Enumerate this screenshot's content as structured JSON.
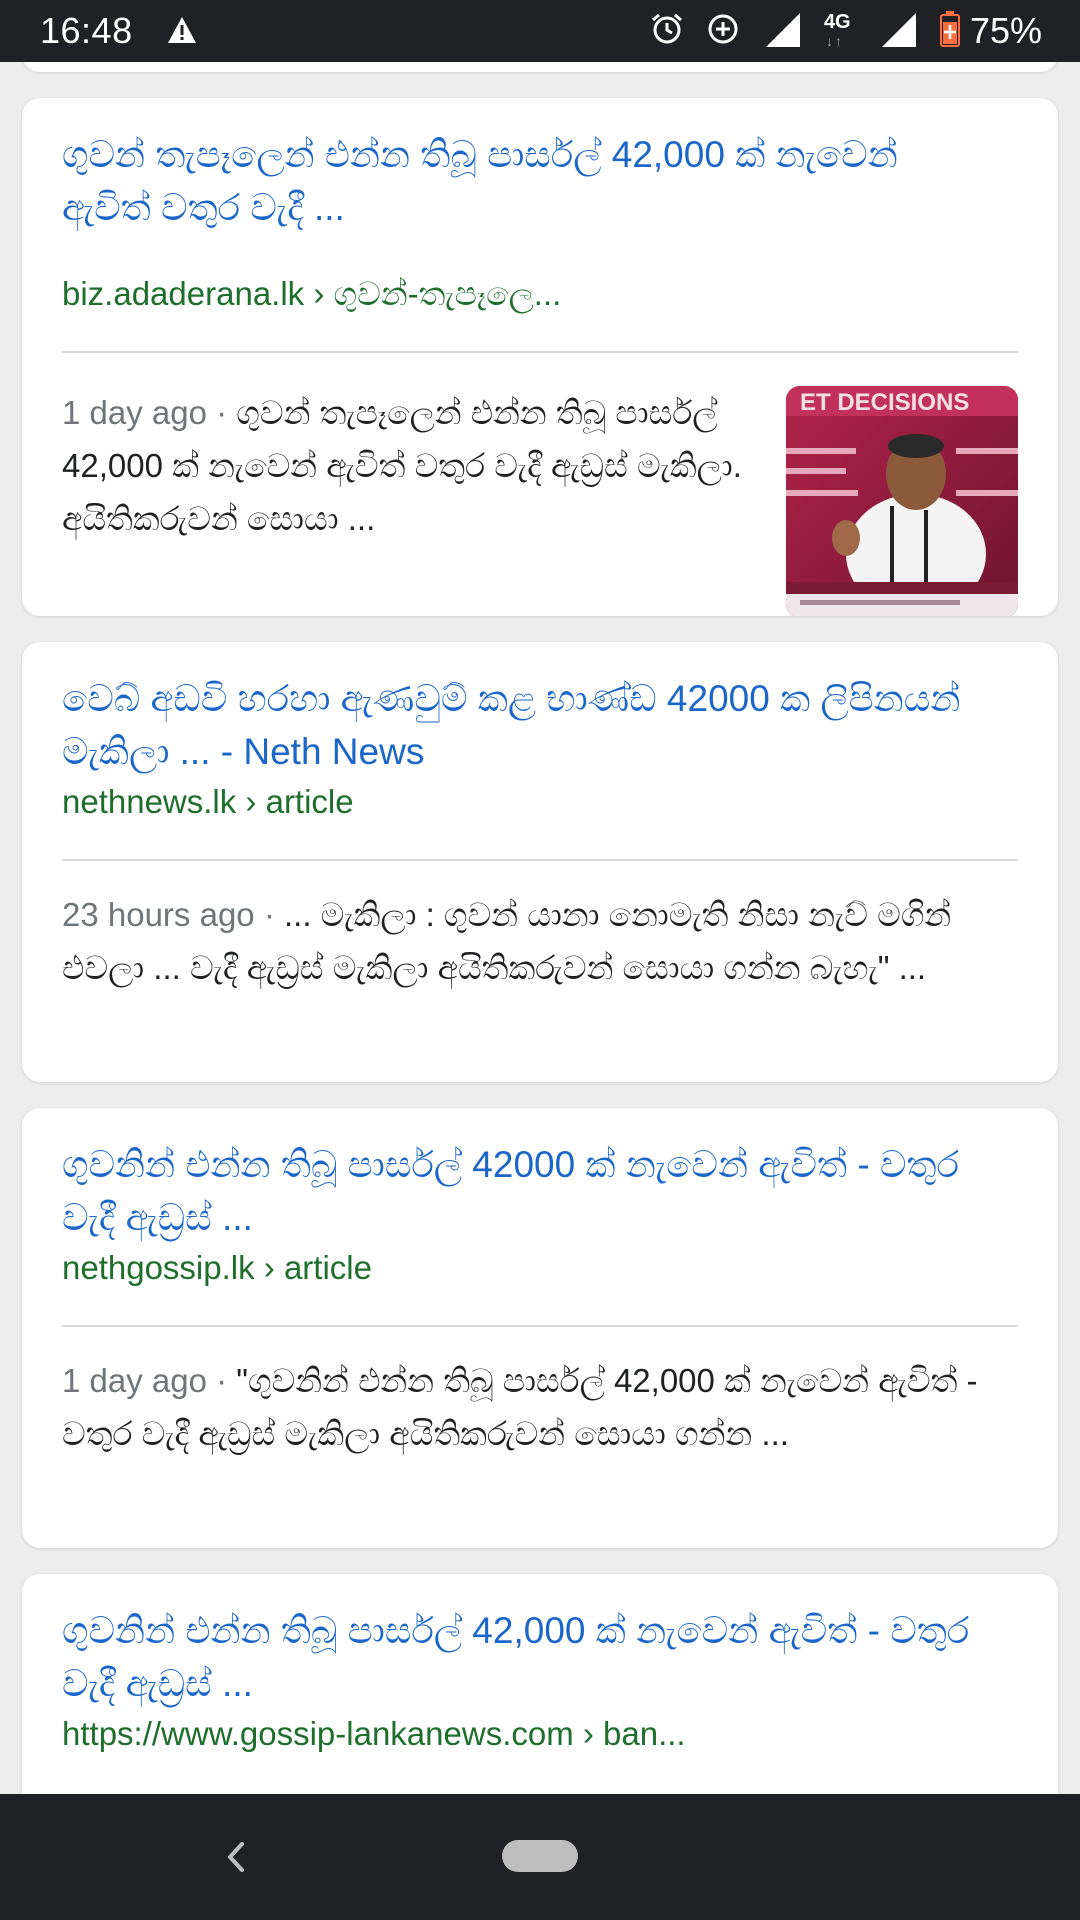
{
  "status_bar": {
    "time": "16:48",
    "battery_percent": "75%",
    "network_label": "4G",
    "icons": [
      "warning-icon",
      "alarm-icon",
      "data-saver-icon",
      "wifi-signal-icon",
      "cell-signal-icon",
      "battery-icon"
    ]
  },
  "results": [
    {
      "title": "ගුවන් තැපෑලෙන් එන්න තිබූ පාර්සල් 42,000 ක් නැවෙන් ඇවිත් වතුර වැදී ...",
      "url": "biz.adaderana.lk › ගුවන්-තැපෑලෙ...",
      "date": "1 day ago",
      "snippet": "ගුවන් තැපෑලෙන් එන්න තිබූ පාර්සල් 42,000 ක් නැවෙන් ඇවිත් වතුර වැදී ඇඩ්‍රස් මැකිලා. අයිතිකරුවන් සොයා ...",
      "thumbnail_text": "ET DECISIONS"
    },
    {
      "title": "වෙබ් අඩවි හරහා ඇණවුම් කළ භාණ්ඩ 42000 ක ලිපිනයන් මැකිලා ... - Neth News",
      "url": "nethnews.lk › article",
      "date": "23 hours ago",
      "snippet": "... මැකිලා : ගුවන් යානා නොමැති නිසා නැව් මගින් එවලා ... වැදී ඇඩ්‍රස් මැකිලා අයිතිකරුවන් සොයා ගන්න බැහැ\" ..."
    },
    {
      "title": "ගුවනින් එන්න තිබූ පාර්සල් 42000 ක් නැවෙන් ඇවිත් - වතුර වැදී ඇඩ්‍රස් ...",
      "url": "nethgossip.lk › article",
      "date": "1 day ago",
      "snippet": "\"ගුවනින් එන්න තිබූ පාර්සල් 42,000 ක් නැවෙන් ඇවිත් - වතුර වැදී ඇඩ්‍රස් මැකිලා අයිතිකරුවන් සොයා ගන්න ..."
    },
    {
      "title": "ගුවනින් එන්න තිබූ පාර්සල් 42,000 ක් නැවෙන් ඇවිත් - වතුර වැදී ඇඩ්‍රස් ...",
      "url": "https://www.gossip-lankanews.com › ban..."
    }
  ],
  "colors": {
    "title_link": "#1a66c9",
    "url_green": "#1e6e2c",
    "snippet_text": "#202124",
    "date_gray": "#70757a",
    "page_bg": "#ededed",
    "bar_bg": "#202124"
  },
  "nav_bar": {
    "icons": [
      "back-icon",
      "home-pill-icon"
    ]
  }
}
